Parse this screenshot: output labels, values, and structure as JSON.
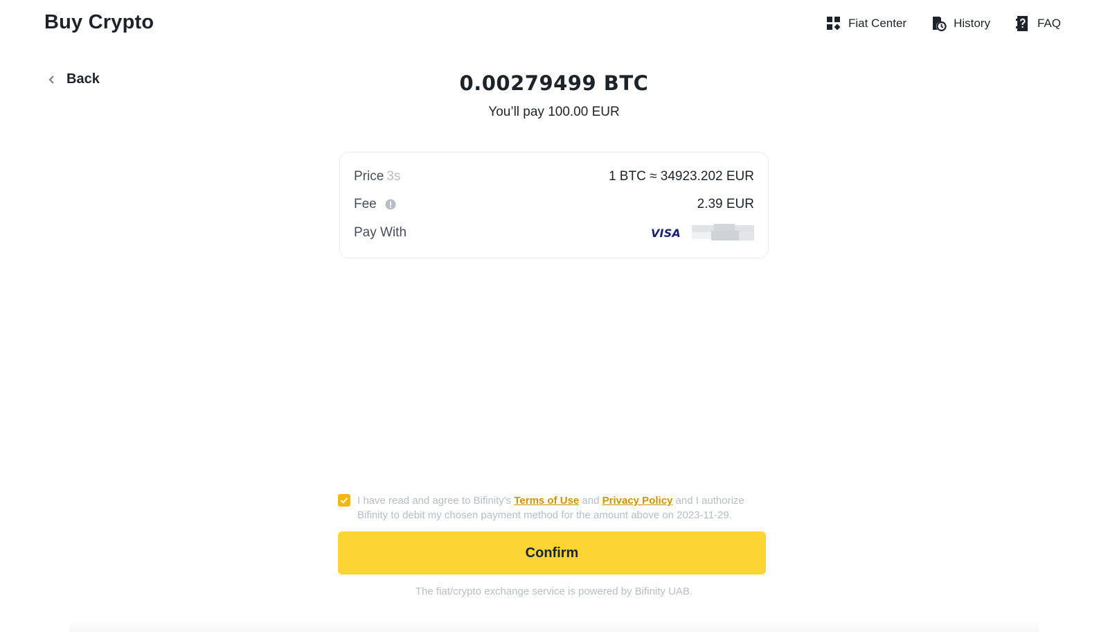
{
  "header": {
    "title": "Buy Crypto",
    "nav": [
      {
        "label": "Fiat Center",
        "icon": "grid-icon"
      },
      {
        "label": "History",
        "icon": "history-icon"
      },
      {
        "label": "FAQ",
        "icon": "faq-icon"
      }
    ]
  },
  "back": {
    "label": "Back",
    "icon": "chevron-left-icon"
  },
  "summary": {
    "amount": "0.00279499 BTC",
    "pay_line": "You’ll pay 100.00 EUR"
  },
  "details": {
    "price_label": "Price",
    "price_timer": "3s",
    "price_value": "1 BTC ≈ 34923.202 EUR",
    "fee_label": "Fee",
    "fee_value": "2.39 EUR",
    "pay_with_label": "Pay With",
    "card_brand": "VISA"
  },
  "agreement": {
    "checked": true,
    "text_1": "I have read and agree to Bifinity's ",
    "terms_link": "Terms of Use",
    "text_2": " and ",
    "privacy_link": "Privacy Policy",
    "text_3": " and I authorize Bifinity to debit my chosen payment method for the amount above on 2023-11-29."
  },
  "confirm_label": "Confirm",
  "footer_note": "The fiat/crypto exchange service is powered by Bifinity UAB.",
  "colors": {
    "accent": "#fcd535",
    "checkbox": "#f0b90b",
    "link": "#c99400",
    "muted": "#b7bdc6"
  }
}
